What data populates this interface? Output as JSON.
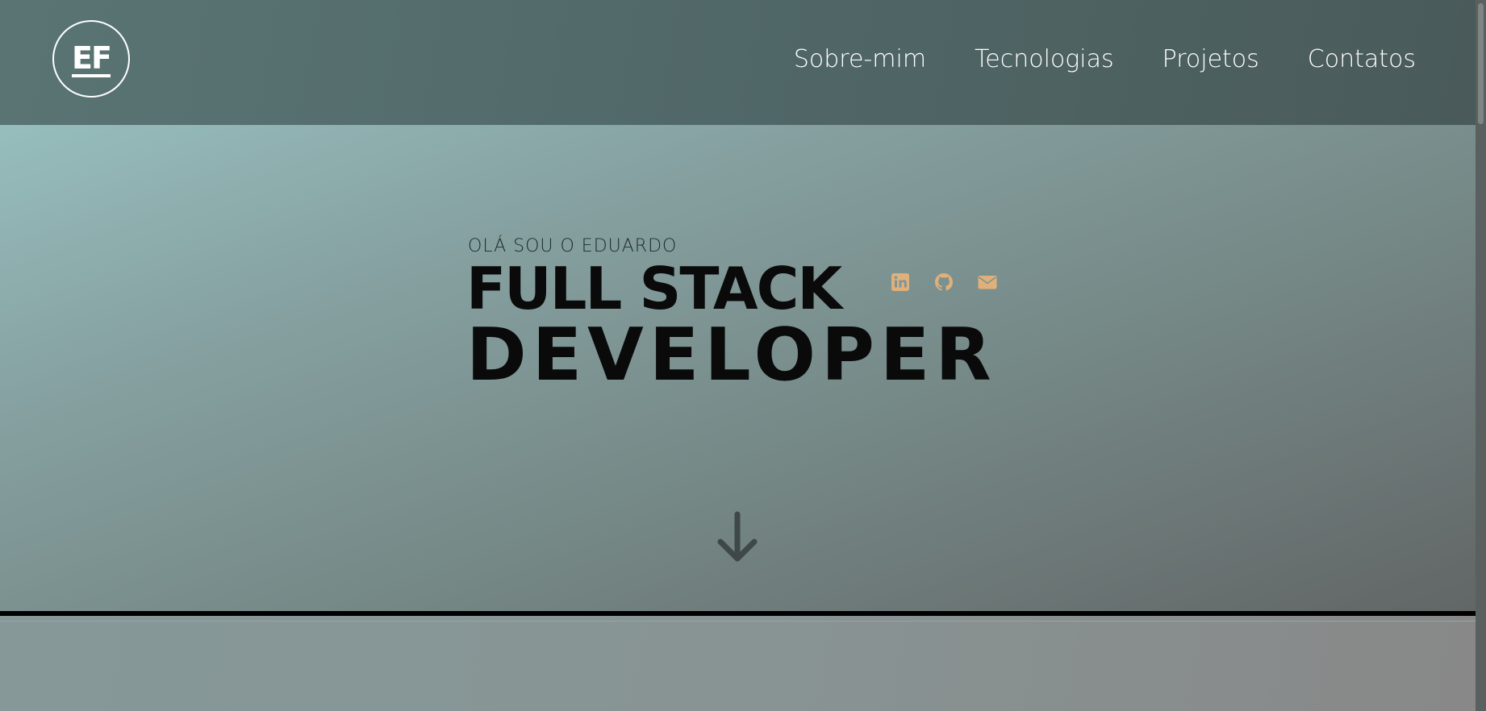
{
  "header": {
    "logo_text": "EF",
    "nav": [
      {
        "label": "Sobre-mim"
      },
      {
        "label": "Tecnologias"
      },
      {
        "label": "Projetos"
      },
      {
        "label": "Contatos"
      }
    ]
  },
  "hero": {
    "greeting": "OLÁ SOU O EDUARDO",
    "headline_line1": "FULL STACK",
    "headline_line2": "DEVELOPER",
    "socials": [
      {
        "icon": "linkedin-icon"
      },
      {
        "icon": "github-icon"
      },
      {
        "icon": "envelope-icon"
      }
    ],
    "scroll_icon": "arrow-down-icon"
  },
  "colors": {
    "accent": "#e0b07a",
    "header_bg": "#536b6b",
    "text_dark": "#0a0a0a",
    "nav_text": "#ffffff"
  }
}
